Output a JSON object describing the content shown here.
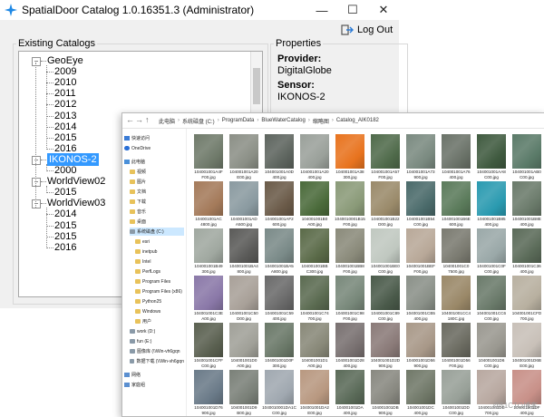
{
  "window": {
    "title": "SpatialDoor Catalog 1.0.16351.3 (Administrator)",
    "minimize_glyph": "—",
    "maximize_glyph": "☐",
    "close_glyph": "✕",
    "logout_label": "Log Out"
  },
  "catalogs": {
    "group_label": "Existing Catalogs",
    "tree": [
      {
        "label": "GeoEye",
        "expanded": true,
        "children": [
          "2009",
          "2010",
          "2011",
          "2012",
          "2013",
          "2014",
          "2015",
          "2016"
        ]
      },
      {
        "label": "IKONOS-2",
        "expanded": true,
        "selected": true,
        "children": [
          "2000"
        ]
      },
      {
        "label": "WorldView02",
        "expanded": true,
        "children": [
          "2015"
        ]
      },
      {
        "label": "WorldView03",
        "expanded": true,
        "children": [
          "2014",
          "2015",
          "2015",
          "2016"
        ]
      }
    ]
  },
  "properties": {
    "group_label": "Properties",
    "provider_label": "Provider:",
    "provider_value": "DigitalGlobe",
    "sensor_label": "Sensor:",
    "sensor_value": "IKONOS-2"
  },
  "explorer": {
    "breadcrumb": [
      "此电脑",
      "系统磁盘 (C:)",
      "ProgramData",
      "BlueWaterCatalog",
      "缩略图",
      "Catalog_AIK0182"
    ],
    "nav_items": [
      {
        "label": "快速访问",
        "icon": "star-icon",
        "indent": 0
      },
      {
        "label": "OneDrive",
        "icon": "cloud-icon",
        "indent": 0
      },
      {
        "label": "此电脑",
        "icon": "pc-icon",
        "indent": 0
      },
      {
        "label": "视频",
        "icon": "folder-icon",
        "indent": 1
      },
      {
        "label": "图片",
        "icon": "folder-icon",
        "indent": 1
      },
      {
        "label": "文档",
        "icon": "folder-icon",
        "indent": 1
      },
      {
        "label": "下载",
        "icon": "folder-icon",
        "indent": 1
      },
      {
        "label": "音乐",
        "icon": "folder-icon",
        "indent": 1
      },
      {
        "label": "桌面",
        "icon": "folder-icon",
        "indent": 1
      },
      {
        "label": "系统磁盘 (C:)",
        "icon": "drive-icon",
        "indent": 1,
        "selected": true
      },
      {
        "label": "esri",
        "icon": "folder-icon",
        "indent": 2
      },
      {
        "label": "inetpub",
        "icon": "folder-icon",
        "indent": 2
      },
      {
        "label": "Intel",
        "icon": "folder-icon",
        "indent": 2
      },
      {
        "label": "PerfLogs",
        "icon": "folder-icon",
        "indent": 2
      },
      {
        "label": "Program Files",
        "icon": "folder-icon",
        "indent": 2
      },
      {
        "label": "Program Files (x86)",
        "icon": "folder-icon",
        "indent": 2
      },
      {
        "label": "Python25",
        "icon": "folder-icon",
        "indent": 2
      },
      {
        "label": "Windows",
        "icon": "folder-icon",
        "indent": 2
      },
      {
        "label": "用户",
        "icon": "folder-icon",
        "indent": 2
      },
      {
        "label": "work (D:)",
        "icon": "drive-icon",
        "indent": 1
      },
      {
        "label": "fun (E:)",
        "icon": "drive-icon",
        "indent": 1
      },
      {
        "label": "图像库 (\\\\Win-vh6gqn",
        "icon": "drive-icon",
        "indent": 1
      },
      {
        "label": "数据下载 (\\\\Win-vh6gqn",
        "icon": "drive-icon",
        "indent": 1
      },
      {
        "label": "网络",
        "icon": "network-icon",
        "indent": 0
      },
      {
        "label": "家庭组",
        "icon": "network-icon",
        "indent": 0
      }
    ],
    "thumbs": [
      {
        "cap1": "104001001A4F",
        "cap2": "F00.jpg",
        "color": "#6f7a6a"
      },
      {
        "cap1": "104001001A20",
        "cap2": "E00.jpg",
        "color": "#8b8f86"
      },
      {
        "cap1": "104001001A0D",
        "cap2": "400.jpg",
        "color": "#5d645e"
      },
      {
        "cap1": "104001001A20",
        "cap2": "400.jpg",
        "color": "#9aa09a"
      },
      {
        "cap1": "104001001A38",
        "cap2": "300.jpg",
        "color": "#e8731e"
      },
      {
        "cap1": "104001001A57",
        "cap2": "F00.jpg",
        "color": "#4f6a4a"
      },
      {
        "cap1": "104001001A73",
        "cap2": "900.jpg",
        "color": "#7a8a80"
      },
      {
        "cap1": "104001001A76",
        "cap2": "400.jpg",
        "color": "#6a7268"
      },
      {
        "cap1": "104001001AA8",
        "cap2": "C00.jpg",
        "color": "#3f5a3f"
      },
      {
        "cap1": "104001001AB0",
        "cap2": "C00.jpg",
        "color": "#5a7a68"
      },
      {
        "cap1": "104001001AC",
        "cap2": "4800.jpg",
        "color": "#a47a5a"
      },
      {
        "cap1": "104001001AD",
        "cap2": "A500.jpg",
        "color": "#8a9aa0"
      },
      {
        "cap1": "104001001AF2",
        "cap2": "600.jpg",
        "color": "#6a5a48"
      },
      {
        "cap1": "104001001B0",
        "cap2": "A00.jpg",
        "color": "#4a6a3a"
      },
      {
        "cap1": "1040010001B15",
        "cap2": "F00.jpg",
        "color": "#8a9a78"
      },
      {
        "cap1": "104001001B22",
        "cap2": "D00.jpg",
        "color": "#9a8a6a"
      },
      {
        "cap1": "104001001B54",
        "cap2": "C00.jpg",
        "color": "#4a6a6a"
      },
      {
        "cap1": "104001001B6E",
        "cap2": "600.jpg",
        "color": "#5a7a5a"
      },
      {
        "cap1": "104001001B85",
        "cap2": "400.jpg",
        "color": "#2a9ab0"
      },
      {
        "cap1": "104001001B8E",
        "cap2": "400.jpg",
        "color": "#6a7a6a"
      },
      {
        "cap1": "104001001B49",
        "cap2": "300.jpg",
        "color": "#a0a8a0"
      },
      {
        "cap1": "104001001BA4",
        "cap2": "800.jpg",
        "color": "#5a5a58"
      },
      {
        "cap1": "104001001BA5",
        "cap2": "A800.jpg",
        "color": "#7a8a88"
      },
      {
        "cap1": "104001001BB",
        "cap2": "C300.jpg",
        "color": "#5a6a48"
      },
      {
        "cap1": "104001001BB8",
        "cap2": "F00.jpg",
        "color": "#8a8a7a"
      },
      {
        "cap1": "104001001BE0",
        "cap2": "C00.jpg",
        "color": "#c0c8c0"
      },
      {
        "cap1": "104001001BEF",
        "cap2": "F00.jpg",
        "color": "#b8a898"
      },
      {
        "cap1": "104001001C0",
        "cap2": "7500.jpg",
        "color": "#7a7a70"
      },
      {
        "cap1": "104001001C0F",
        "cap2": "C00.jpg",
        "color": "#9aa8a8"
      },
      {
        "cap1": "104001001C36",
        "cap2": "400.jpg",
        "color": "#5a6a58"
      },
      {
        "cap1": "104001001C3E",
        "cap2": "A00.jpg",
        "color": "#8a78a8"
      },
      {
        "cap1": "104001001C50",
        "cap2": "D00.jpg",
        "color": "#a8a098"
      },
      {
        "cap1": "104001001C59",
        "cap2": "400.jpg",
        "color": "#6a6a6a"
      },
      {
        "cap1": "104001001C74",
        "cap2": "700.jpg",
        "color": "#5a6a50"
      },
      {
        "cap1": "104001001C98",
        "cap2": "F00.jpg",
        "color": "#78887a"
      },
      {
        "cap1": "104001001C89",
        "cap2": "C00.jpg",
        "color": "#4a5a4a"
      },
      {
        "cap1": "104001001CB5",
        "cap2": "400.jpg",
        "color": "#8a9088"
      },
      {
        "cap1": "104001001CC4",
        "cap2": "180C.jpg",
        "color": "#9a8868"
      },
      {
        "cap1": "104001001CC6",
        "cap2": "C00.jpg",
        "color": "#6a7a6a"
      },
      {
        "cap1": "104001001CFD",
        "cap2": "700.jpg",
        "color": "#b8b0a0"
      },
      {
        "cap1": "104001001CFF",
        "cap2": "C00.jpg",
        "color": "#5a6050"
      },
      {
        "cap1": "104001001D0",
        "cap2": "A00.jpg",
        "color": "#a0a098"
      },
      {
        "cap1": "104001001D0F",
        "cap2": "300.jpg",
        "color": "#6a7868"
      },
      {
        "cap1": "104001001D1",
        "cap2": "A00.jpg",
        "color": "#888878"
      },
      {
        "cap1": "104001001D28",
        "cap2": "400.jpg",
        "color": "#787070"
      },
      {
        "cap1": "104001001D2D",
        "cap2": "900.jpg",
        "color": "#8a7a78"
      },
      {
        "cap1": "104001001D56",
        "cap2": "900.jpg",
        "color": "#a89888"
      },
      {
        "cap1": "104001001D56",
        "cap2": "F00.jpg",
        "color": "#6a6a60"
      },
      {
        "cap1": "104001001D6",
        "cap2": "C00.jpg",
        "color": "#9a9890"
      },
      {
        "cap1": "104001001D6B",
        "cap2": "E00.jpg",
        "color": "#c8c0b8"
      },
      {
        "cap1": "104001001D76",
        "cap2": "900.jpg",
        "color": "#6a7a88"
      },
      {
        "cap1": "104001001D9",
        "cap2": "B00.jpg",
        "color": "#7a8078"
      },
      {
        "cap1": "1040010001DA1C",
        "cap2": "C00.jpg",
        "color": "#a0a8b0"
      },
      {
        "cap1": "104001001DA2",
        "cap2": "E00.jpg",
        "color": "#b89880"
      },
      {
        "cap1": "104001001DA",
        "cap2": "400.jpg",
        "color": "#5a6a58"
      },
      {
        "cap1": "104001001DB",
        "cap2": "900.jpg",
        "color": "#888880"
      },
      {
        "cap1": "104001001DC",
        "cap2": "400.jpg",
        "color": "#707868"
      },
      {
        "cap1": "104001001DD",
        "cap2": "C00.jpg",
        "color": "#98a098"
      },
      {
        "cap1": "104001001DE",
        "cap2": "700.jpg",
        "color": "#b8a8a0"
      },
      {
        "cap1": "104001001DF",
        "cap2": "400.jpg",
        "color": "#c89088"
      }
    ],
    "watermark": "@51CTO博客"
  }
}
